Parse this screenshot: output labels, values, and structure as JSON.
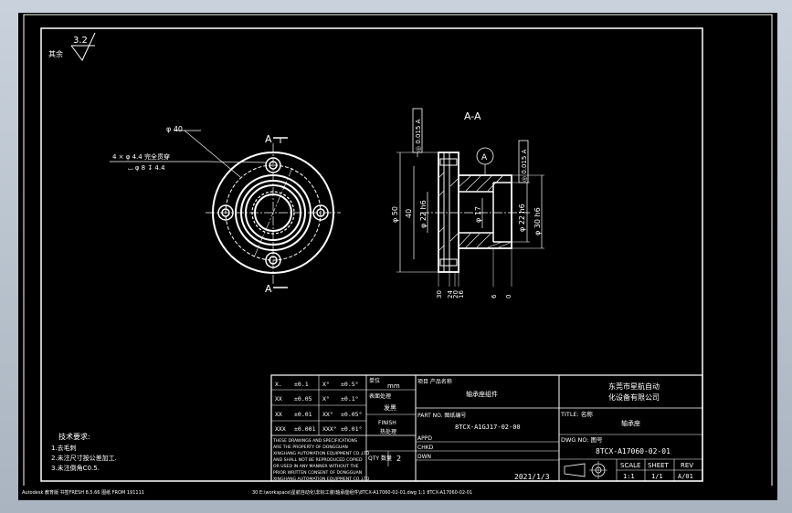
{
  "surface_roughness": {
    "value": "3.2",
    "note": "其余"
  },
  "section_label": "A-A",
  "section_markers": {
    "top": "A",
    "bottom": "A",
    "datum": "A"
  },
  "front_view": {
    "dim_d40": "φ 40",
    "hole_callout_line1": "4 × φ 4.4 完全贯穿",
    "hole_callout_line2": "⌴ φ 8 ↧ 4.4"
  },
  "section_view": {
    "tol_left": "◎ 0.015 A",
    "tol_right": "◎ 0.015 A",
    "dim_d50": "φ 50",
    "dim_40": "40",
    "dim_d22_left": "φ 22 h6",
    "dim_d17": "φ 17",
    "dim_d22_right": "φ 22 h6",
    "dim_d30": "φ 30 h6",
    "bottom_dims": [
      "30",
      "24",
      "20",
      "16",
      "6",
      "0"
    ]
  },
  "tech_requirements": {
    "title": "技术要求:",
    "items": [
      "1.去毛刺",
      "2.未注尺寸按公差加工.",
      "3.未注倒角C0.5."
    ]
  },
  "tolerance_table": {
    "rows": [
      [
        "X.",
        "±0.1",
        "X°",
        "±0.5°"
      ],
      [
        "XX",
        "±0.05",
        "X°",
        "±0.1°"
      ],
      [
        "XX",
        "±0.01",
        "XX°",
        "±0.05°"
      ],
      [
        "XXX",
        "±0.001",
        "XXX°",
        "±0.01°"
      ]
    ],
    "unit_label": "单位",
    "unit_value": "mm",
    "surface_label": "表面处理",
    "surface_value": "发黑",
    "finish_label": "FINISH",
    "finish_value": "热处理",
    "notice": [
      "THESE DRAWINGS AND SPECIFICATIONS",
      "ARE  THE  PROPERTY  OF  DONGGUAN",
      "XINGHANG AUTOMATION EQUIPMENT CO.,LTD",
      "AND SHALL NOT BE REPRODUCED COPIED",
      "OR USED IN ANY MANNER WITHOUT THE",
      "PRIOR WRITTEN CONSENT OF  DONGGUAN",
      "XINGHANG AUTOMATION EQUIPMENT CO.,LTD"
    ],
    "qty_label": "QTY 数量",
    "qty_value": "2"
  },
  "title_block": {
    "project_label": "项目 产品名称",
    "project_value": "轴承座组件",
    "part_label": "PART NO. 图纸编号",
    "part_value": "8TCX-A1GJ17-02-00",
    "appd_label": "APPD",
    "chkd_label": "CHKD",
    "dwn_label": "DWN",
    "date": "2021/1/3",
    "company": [
      "东莞市星航自动",
      "化设备有限公司"
    ],
    "title_label": "TITLE: 名称",
    "title_value": "轴承座",
    "dwg_label": "DWG NO: 图号",
    "dwg_value": "8TCX-A17060-02-01",
    "scale_label": "SCALE",
    "scale_value": "1:1",
    "sheet_label": "SHEET",
    "sheet_value": "1/1",
    "rev_label": "REV",
    "rev_value": "A/01"
  },
  "status_bar": {
    "left": "Autodesk 教育版  书签FRESH 8.5.66 图纸 FROM 191111",
    "right": "30  E:\\workspace\\星航自动化\\非标工装\\轴承座组件\\8TCX-A17060-02-01.dwg  1:1  8TCX-A17060-02-01"
  }
}
